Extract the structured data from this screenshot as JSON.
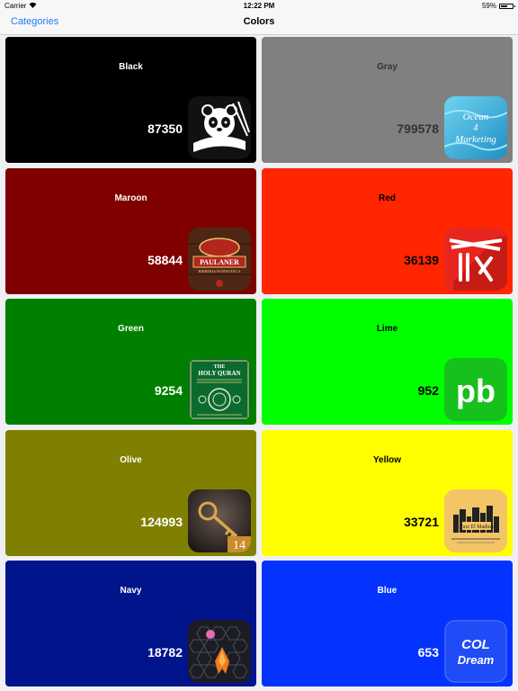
{
  "status_bar": {
    "carrier": "Carrier",
    "time": "12:22 PM",
    "battery": "59%",
    "battery_level": 0.59
  },
  "nav": {
    "back_label": "Categories",
    "title": "Colors"
  },
  "colors": {
    "black": "#000000",
    "gray": "#808080",
    "maroon": "#800000",
    "red": "#ff2600",
    "green": "#008000",
    "lime": "#00ff00",
    "olive": "#808000",
    "yellow": "#ffff00",
    "navy": "#00148c",
    "blue": "#0433ff",
    "ios_blue": "#1a7cf5"
  },
  "tiles": [
    {
      "name": "Black",
      "count": "87350",
      "text_color": "#ffffff",
      "icon": "panda-app-icon"
    },
    {
      "name": "Gray",
      "count": "799578",
      "text_color": "#333333",
      "icon": "ocean-marketing-app-icon",
      "icon_text": [
        "Ocean",
        "4",
        "Marketing"
      ]
    },
    {
      "name": "Maroon",
      "count": "58844",
      "text_color": "#ffffff",
      "icon": "paulaner-app-icon",
      "icon_text": [
        "PAULANER",
        "BIRRERIA PANINOTECA"
      ]
    },
    {
      "name": "Red",
      "count": "36139",
      "text_color": "#000000",
      "icon": "red-chopsticks-app-icon"
    },
    {
      "name": "Green",
      "count": "9254",
      "text_color": "#ffffff",
      "icon": "holy-quran-app-icon",
      "icon_text": [
        "THE",
        "HOLY QURAN"
      ]
    },
    {
      "name": "Lime",
      "count": "952",
      "text_color": "#000000",
      "icon": "pb-app-icon",
      "icon_text": [
        "pb"
      ]
    },
    {
      "name": "Olive",
      "count": "124993",
      "text_color": "#ffffff",
      "icon": "key-app-icon",
      "icon_text": [
        "14"
      ]
    },
    {
      "name": "Yellow",
      "count": "33721",
      "text_color": "#000000",
      "icon": "taxi-el-madina-app-icon",
      "icon_text": [
        "Taxi El Madina"
      ]
    },
    {
      "name": "Navy",
      "count": "18782",
      "text_color": "#ffffff",
      "icon": "rocket-hexagon-app-icon"
    },
    {
      "name": "Blue",
      "count": "653",
      "text_color": "#ffffff",
      "icon": "col-dream-app-icon",
      "icon_text": [
        "COL",
        "Dream"
      ]
    }
  ]
}
